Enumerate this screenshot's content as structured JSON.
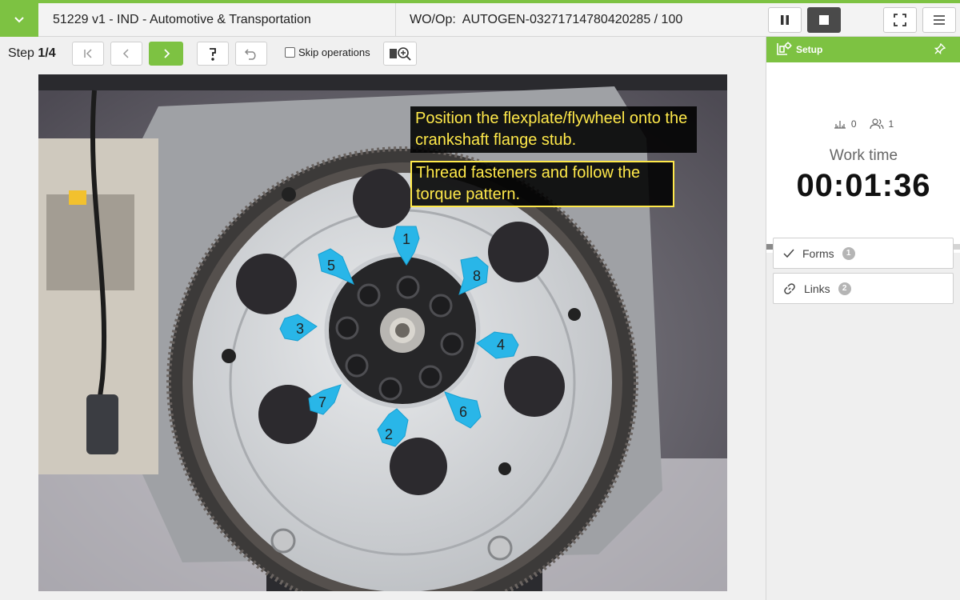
{
  "header": {
    "title": "51229 v1 - IND - Automotive & Transportation",
    "wo_op": "WO/Op:  AUTOGEN-03271714780420285 / 100"
  },
  "step": {
    "prefix": "Step ",
    "current": "1/4",
    "skip_label": "Skip operations"
  },
  "callouts": [
    "Position the flexplate/flywheel onto the crankshaft flange stub.",
    "Thread fasteners and follow the torque pattern."
  ],
  "torque_markers": [
    "1",
    "2",
    "3",
    "4",
    "5",
    "6",
    "7",
    "8"
  ],
  "panel": {
    "setup_label": "Setup",
    "count_a": "0",
    "count_b": "1",
    "worktime_label": "Work time",
    "worktime_value": "00:01:36",
    "forms_label": "Forms",
    "forms_count": "1",
    "links_label": "Links",
    "links_count": "2"
  },
  "colors": {
    "accent": "#7dc242",
    "callout_text": "#ffe94a",
    "marker": "#29b6e8"
  }
}
